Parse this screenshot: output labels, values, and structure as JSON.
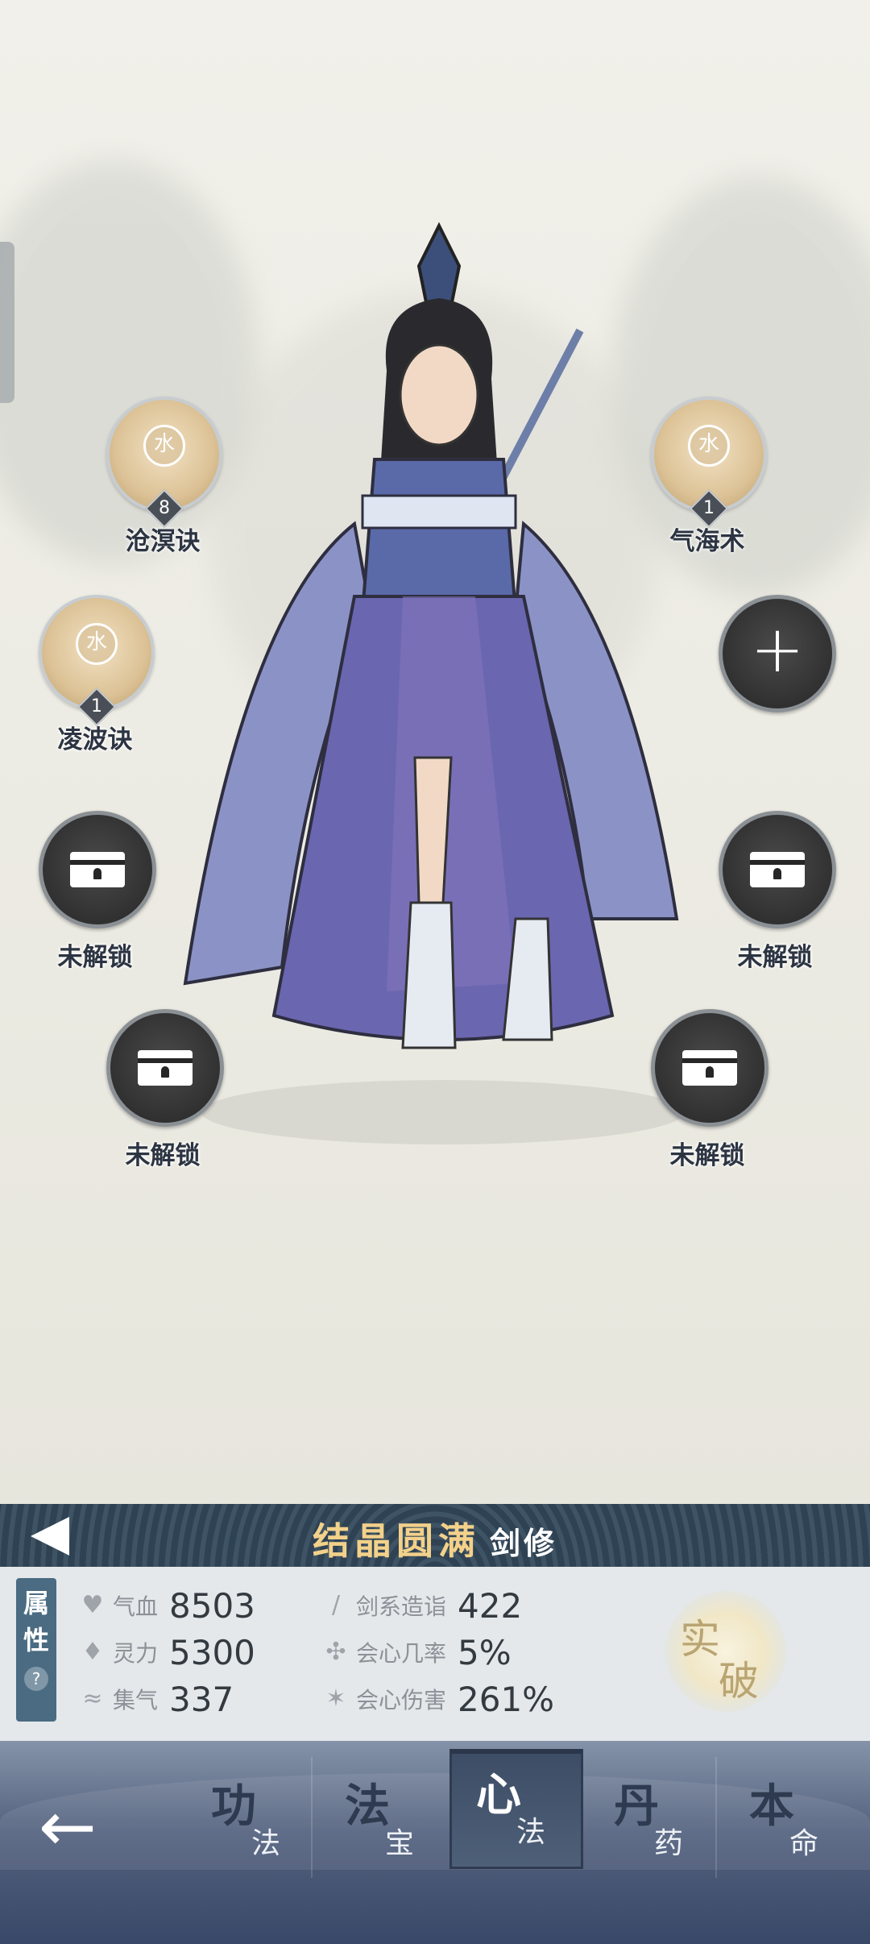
{
  "skills": {
    "left1": {
      "name": "沧溟诀",
      "level": "8",
      "element": "水"
    },
    "right1": {
      "name": "气海术",
      "level": "1",
      "element": "水"
    },
    "left2": {
      "name": "凌波诀",
      "level": "1",
      "element": "水"
    },
    "locked_label": "未解锁"
  },
  "rank": {
    "realm": "结晶圆满",
    "class": "剑修"
  },
  "stats": {
    "tab_label": [
      "属",
      "性"
    ],
    "help": "?",
    "items": [
      {
        "label": "气血",
        "value": "8503",
        "icon": "heart-icon"
      },
      {
        "label": "灵力",
        "value": "5300",
        "icon": "flame-icon"
      },
      {
        "label": "集气",
        "value": "337",
        "icon": "swirl-icon"
      },
      {
        "label": "剑系造诣",
        "value": "422",
        "icon": "sword-icon"
      },
      {
        "label": "会心几率",
        "value": "5%",
        "icon": "critical-icon"
      },
      {
        "label": "会心伤害",
        "value": "261%",
        "icon": "burst-icon"
      }
    ],
    "breakthrough": [
      "实",
      "破"
    ]
  },
  "nav": {
    "back_icon": "arrow-left-icon",
    "tabs": [
      {
        "big": "功",
        "small": "法"
      },
      {
        "big": "法",
        "small": "宝"
      },
      {
        "big": "心",
        "small": "法",
        "active": true
      },
      {
        "big": "丹",
        "small": "药"
      },
      {
        "big": "本",
        "small": "命"
      }
    ]
  },
  "colors": {
    "realm": "#f3d18a",
    "panel": "#e4e8eb",
    "nav": "#53617e",
    "robe": "#5a63a8"
  }
}
